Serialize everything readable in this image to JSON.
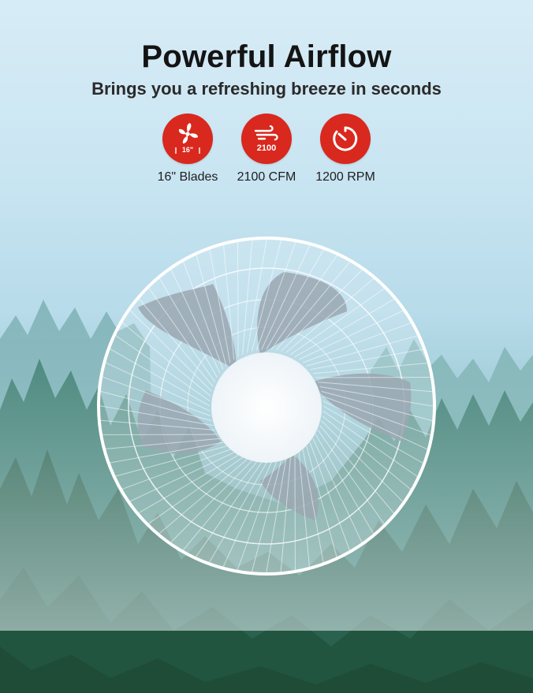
{
  "header": {
    "title": "Powerful Airflow",
    "subtitle": "Brings you a refreshing breeze in seconds"
  },
  "features": [
    {
      "icon": "fan-blade-icon",
      "badge_text": "16\"",
      "label": "16\" Blades"
    },
    {
      "icon": "wind-icon",
      "badge_text": "2100",
      "label": "2100 CFM"
    },
    {
      "icon": "timer-icon",
      "label": "1200 RPM"
    }
  ],
  "colors": {
    "accent": "#d9281e",
    "sky": "#cbe6f3",
    "forest": "#2c5f4f"
  }
}
